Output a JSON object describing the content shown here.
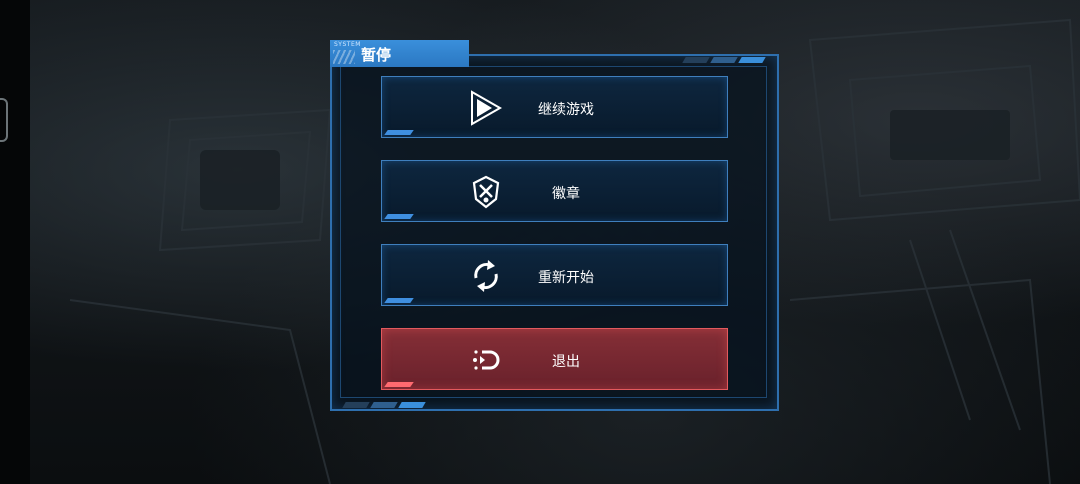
{
  "panel": {
    "system_label": "SYSTEM",
    "title": "暂停"
  },
  "menu": {
    "items": [
      {
        "label": "继续游戏",
        "icon": "play-icon"
      },
      {
        "label": "徽章",
        "icon": "badge-icon"
      },
      {
        "label": "重新开始",
        "icon": "restart-icon"
      },
      {
        "label": "退出",
        "icon": "exit-icon"
      }
    ]
  },
  "colors": {
    "accent_blue": "#3a8fdb",
    "button_border": "#3f7fbd",
    "exit_red": "#e25a5e"
  }
}
